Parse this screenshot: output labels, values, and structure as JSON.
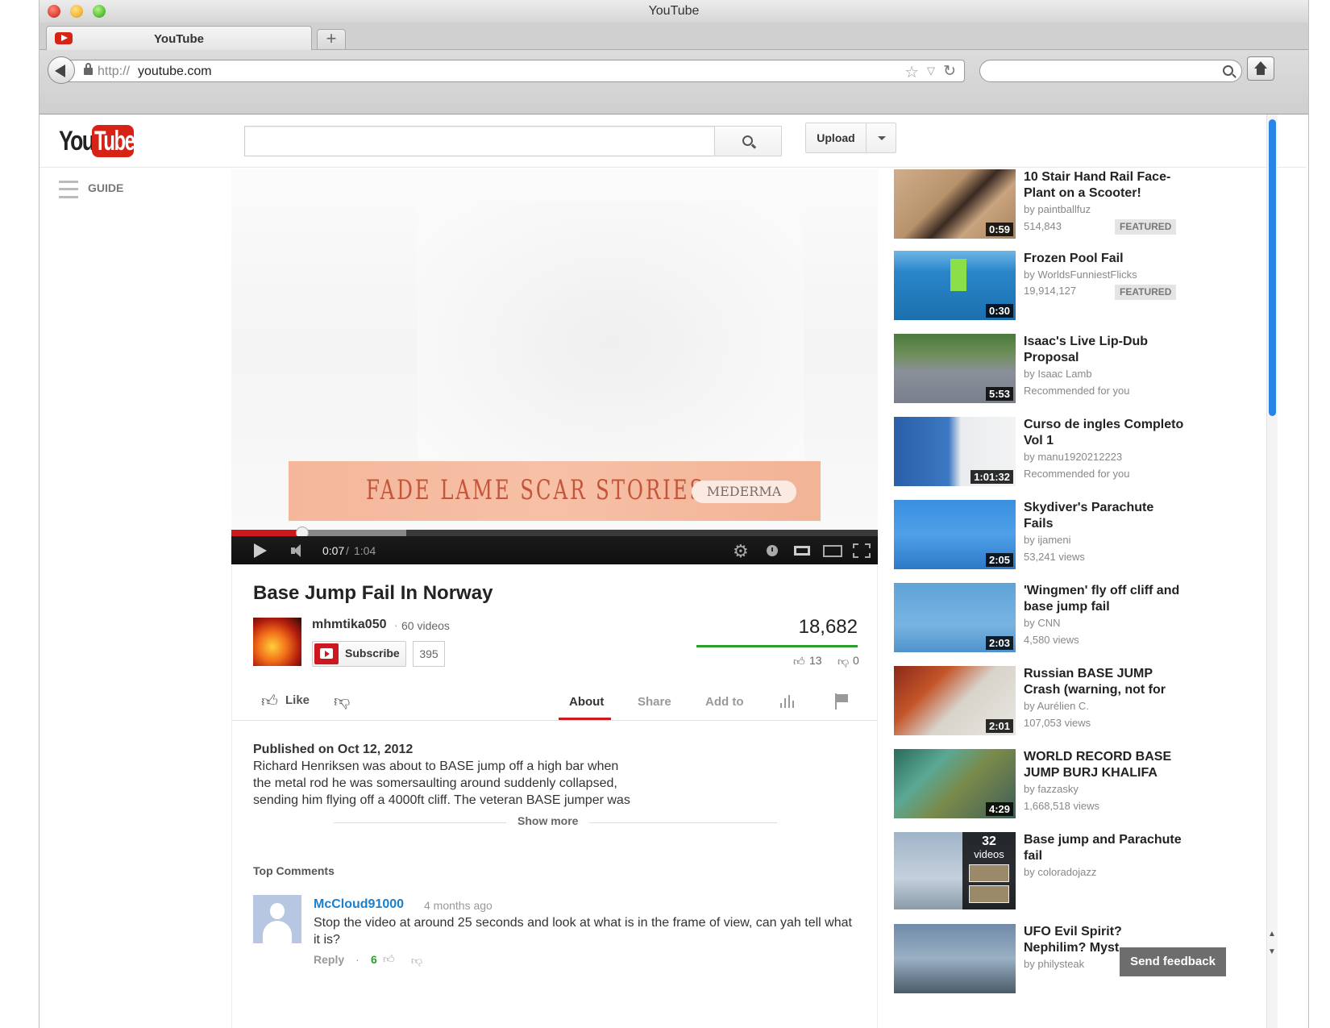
{
  "window": {
    "title": "YouTube"
  },
  "tab": {
    "label": "YouTube",
    "new_tab": "+"
  },
  "address": {
    "scheme": "http://",
    "host": "youtube.com"
  },
  "masthead": {
    "logo_you": "You",
    "logo_tube": "Tube",
    "search_value": "",
    "upload_label": "Upload"
  },
  "guide": {
    "label": "GUIDE"
  },
  "player": {
    "ad_text": "FADE LAME SCAR STORIES.",
    "ad_brand": "MEDERMA",
    "time_current": "0:07",
    "time_separator": "/",
    "time_total": "1:04",
    "progress_played": 0.11,
    "progress_buffered": 0.27
  },
  "video": {
    "title": "Base Jump Fail In Norway",
    "channel": "mhmtika050",
    "channel_separator": "·",
    "channel_videos": "60 videos",
    "subscribe_label": "Subscribe",
    "subscriber_count": "395",
    "view_count": "18,682",
    "likes": "13",
    "dislikes": "0",
    "like_ratio": 1.0
  },
  "actions": {
    "like_label": "Like",
    "tab_about": "About",
    "tab_share": "Share",
    "tab_addto": "Add to"
  },
  "description": {
    "published": "Published on Oct 12, 2012",
    "lines": [
      "Richard Henriksen was about to BASE jump off a high bar when",
      "the metal rod he was somersaulting around suddenly collapsed,",
      "sending him flying off a 4000ft cliff. The veteran BASE jumper was"
    ],
    "show_more": "Show more"
  },
  "comments": {
    "heading": "Top Comments",
    "items": [
      {
        "author": "McCloud91000",
        "time": "4 months ago",
        "text": "Stop the video at around 25 seconds and look at what is in the frame of view, can yah tell what it is?",
        "reply": "Reply",
        "dot": "·",
        "likes": "6"
      }
    ]
  },
  "related": [
    {
      "title": "10 Stair Hand Rail Face-Plant on a Scooter!",
      "by": "by paintballfuz",
      "views": "514,843",
      "duration": "0:59",
      "badge": "FEATURED"
    },
    {
      "title": "Frozen Pool Fail",
      "by": "by WorldsFunniestFlicks",
      "views": "19,914,127",
      "duration": "0:30",
      "badge": "FEATURED"
    },
    {
      "title": "Isaac's Live Lip-Dub Proposal",
      "by": "by Isaac Lamb",
      "views": "Recommended for you",
      "duration": "5:53",
      "badge": ""
    },
    {
      "title": "Curso de ingles Completo Vol 1",
      "by": "by manu1920212223",
      "views": "Recommended for you",
      "duration": "1:01:32",
      "badge": ""
    },
    {
      "title": "Skydiver's Parachute Fails",
      "by": "by ijameni",
      "views": "53,241 views",
      "duration": "2:05",
      "badge": ""
    },
    {
      "title": "'Wingmen' fly off cliff and base jump fail",
      "by": "by CNN",
      "views": "4,580 views",
      "duration": "2:03",
      "badge": ""
    },
    {
      "title": "Russian BASE JUMP Crash (warning, not for",
      "by": "by Aurélien C.",
      "views": "107,053 views",
      "duration": "2:01",
      "badge": ""
    },
    {
      "title": "WORLD RECORD BASE JUMP BURJ KHALIFA",
      "by": "by fazzasky",
      "views": "1,668,518 views",
      "duration": "4:29",
      "badge": ""
    },
    {
      "title": "Base jump and Parachute fail",
      "by": "by coloradojazz",
      "views": "",
      "duration": "",
      "badge": "",
      "playlist_count": "32",
      "playlist_label": "videos"
    },
    {
      "title": "UFO Evil Spirit? Nephilim? Myst",
      "by": "by philysteak",
      "views": "",
      "duration": "",
      "badge": ""
    }
  ],
  "feedback": {
    "label": "Send feedback"
  },
  "colors": {
    "brand_red": "#cc181e",
    "link_blue": "#1b7fcc",
    "like_green": "#2b9e2b",
    "scroll_blue": "#2a86e6"
  },
  "icons": {
    "back": "back-arrow-icon",
    "lock": "lock-icon",
    "star": "bookmark-star-icon",
    "reload": "reload-icon",
    "search": "search-icon",
    "home": "home-icon",
    "guide": "guide-menu-icon",
    "play": "play-icon",
    "volume": "volume-icon",
    "settings": "gear-icon",
    "like": "thumbs-up-icon",
    "dislike": "thumbs-down-icon",
    "stats": "stats-bars-icon",
    "flag": "flag-icon"
  }
}
